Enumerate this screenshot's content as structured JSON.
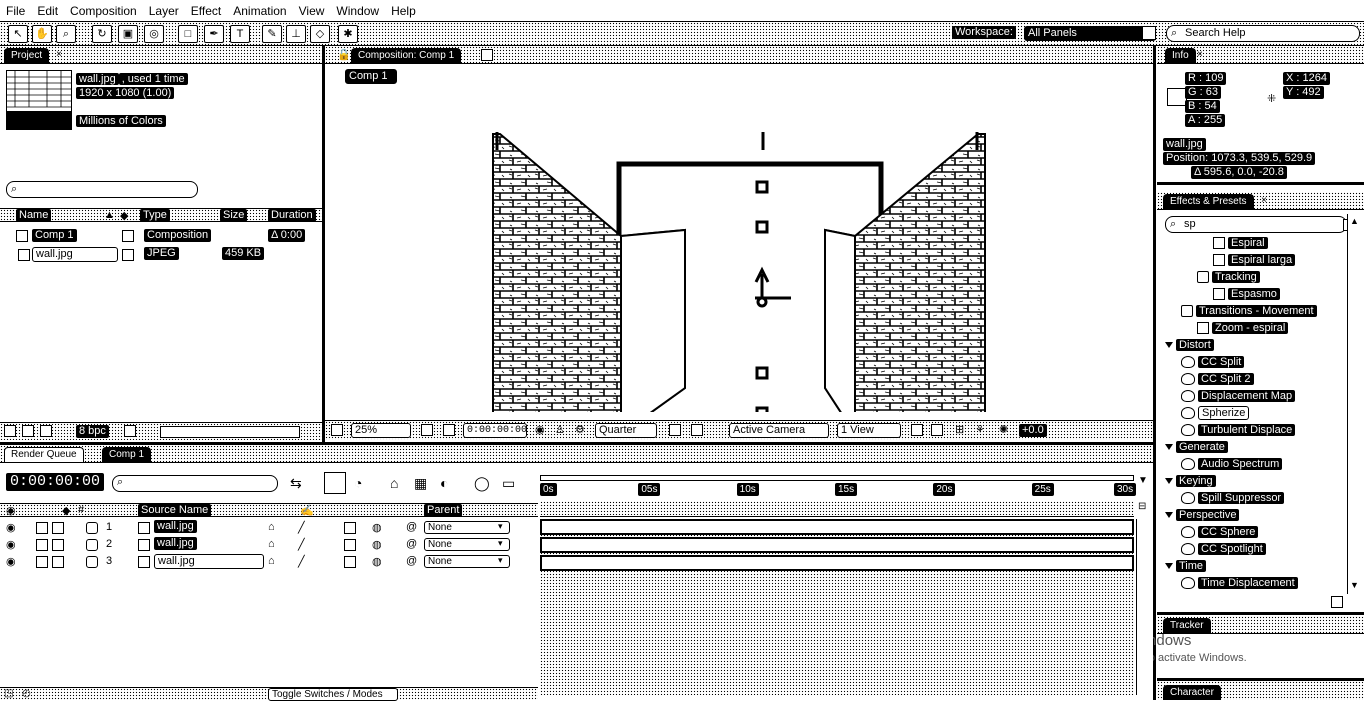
{
  "menu": [
    "File",
    "Edit",
    "Composition",
    "Layer",
    "Effect",
    "Animation",
    "View",
    "Window",
    "Help"
  ],
  "workspace": {
    "label": "Workspace:",
    "value": "All Panels"
  },
  "search_help": {
    "placeholder": "Search Help"
  },
  "project": {
    "tab": "Project",
    "file_name": "wall.jpg",
    "file_usage": ", used 1 time",
    "dimensions": "1920 x 1080 (1.00)",
    "colors": "Millions of Colors",
    "columns": {
      "name": "Name",
      "type": "Type",
      "size": "Size",
      "duration": "Duration"
    },
    "items": [
      {
        "name": "Comp 1",
        "type": "Composition",
        "size": "",
        "duration": "Δ 0:00"
      },
      {
        "name": "wall.jpg",
        "type": "JPEG",
        "size": "459 KB",
        "duration": ""
      }
    ],
    "bpc": "8 bpc"
  },
  "composition": {
    "tab": "Composition: Comp 1",
    "subtab": "Comp 1",
    "zoom": "25%",
    "timecode": "0:00:00:00",
    "resolution": "Quarter",
    "camera": "Active Camera",
    "views": "1 View",
    "exposure": "+0.0"
  },
  "info": {
    "tab": "Info",
    "r": "R : 109",
    "g": "G : 63",
    "b": "B : 54",
    "a": "A : 255",
    "x": "X : 1264",
    "y": "Y : 492",
    "layer": "wall.jpg",
    "position": "Position: 1073.3, 539.5, 529.9",
    "delta": "Δ 595.6, 0.0, -20.8"
  },
  "effects": {
    "tab": "Effects & Presets",
    "search": "sp",
    "tree": [
      {
        "label": "Espiral",
        "level": 3,
        "kind": "preset"
      },
      {
        "label": "Espiral larga",
        "level": 3,
        "kind": "preset"
      },
      {
        "label": "Tracking",
        "level": 2,
        "kind": "folder"
      },
      {
        "label": "Espasmo",
        "level": 3,
        "kind": "preset"
      },
      {
        "label": "Transitions - Movement",
        "level": 1,
        "kind": "folder"
      },
      {
        "label": "Zoom - espiral",
        "level": 2,
        "kind": "preset"
      },
      {
        "label": "Distort",
        "level": 0,
        "kind": "category"
      },
      {
        "label": "CC Split",
        "level": 1,
        "kind": "effect"
      },
      {
        "label": "CC Split 2",
        "level": 1,
        "kind": "effect"
      },
      {
        "label": "Displacement Map",
        "level": 1,
        "kind": "effect"
      },
      {
        "label": "Spherize",
        "level": 1,
        "kind": "effect-selected"
      },
      {
        "label": "Turbulent Displace",
        "level": 1,
        "kind": "effect"
      },
      {
        "label": "Generate",
        "level": 0,
        "kind": "category"
      },
      {
        "label": "Audio Spectrum",
        "level": 1,
        "kind": "effect"
      },
      {
        "label": "Keying",
        "level": 0,
        "kind": "category"
      },
      {
        "label": "Spill Suppressor",
        "level": 1,
        "kind": "effect"
      },
      {
        "label": "Perspective",
        "level": 0,
        "kind": "category"
      },
      {
        "label": "CC Sphere",
        "level": 1,
        "kind": "effect"
      },
      {
        "label": "CC Spotlight",
        "level": 1,
        "kind": "effect"
      },
      {
        "label": "Time",
        "level": 0,
        "kind": "category"
      },
      {
        "label": "Time Displacement",
        "level": 1,
        "kind": "effect"
      }
    ]
  },
  "tracker": {
    "tab": "Tracker",
    "watermark_1": "Activate Windows",
    "watermark_2": "Go to Settings to activate Windows."
  },
  "character": {
    "tab": "Character"
  },
  "timeline": {
    "tab_render": "Render Queue",
    "tab_comp": "Comp 1",
    "timecode": "0:00:00:00",
    "col_source": "Source Name",
    "col_parent": "Parent",
    "layers": [
      {
        "num": "1",
        "name": "wall.jpg",
        "parent": "None"
      },
      {
        "num": "2",
        "name": "wall.jpg",
        "parent": "None"
      },
      {
        "num": "3",
        "name": "wall.jpg",
        "parent": "None"
      }
    ],
    "ruler": [
      "0s",
      "05s",
      "10s",
      "15s",
      "20s",
      "25s",
      "30s"
    ],
    "toggle": "Toggle Switches / Modes"
  }
}
